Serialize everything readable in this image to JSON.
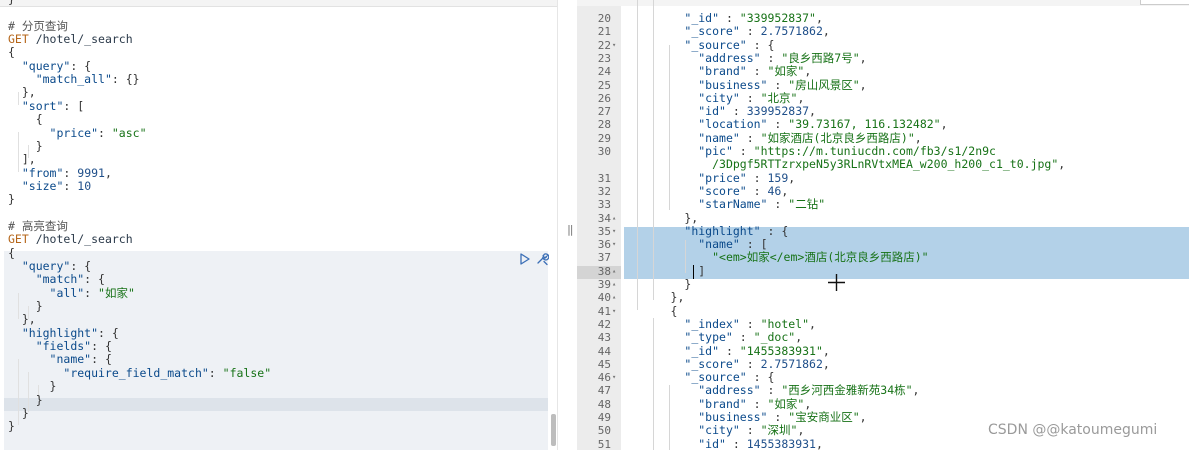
{
  "watermark": "CSDN @@katoumegumi",
  "left_lines": [
    [
      {
        "t": "}",
        "c": "punc"
      }
    ],
    [],
    [
      {
        "t": "# 分页查询",
        "c": "cmt"
      }
    ],
    [
      {
        "t": "GET ",
        "c": "method"
      },
      {
        "t": "/hotel/_search",
        "c": "path"
      }
    ],
    [
      {
        "t": "{",
        "c": "punc"
      }
    ],
    [
      {
        "t": "  ",
        "c": "punc"
      },
      {
        "t": "\"query\"",
        "c": "key"
      },
      {
        "t": ": {",
        "c": "punc"
      }
    ],
    [
      {
        "t": "    ",
        "c": "punc"
      },
      {
        "t": "\"match_all\"",
        "c": "key"
      },
      {
        "t": ": {}",
        "c": "punc"
      }
    ],
    [
      {
        "t": "  },",
        "c": "punc"
      }
    ],
    [
      {
        "t": "  ",
        "c": "punc"
      },
      {
        "t": "\"sort\"",
        "c": "key"
      },
      {
        "t": ": [",
        "c": "punc"
      }
    ],
    [
      {
        "t": "    {",
        "c": "punc"
      }
    ],
    [
      {
        "t": "      ",
        "c": "punc"
      },
      {
        "t": "\"price\"",
        "c": "key"
      },
      {
        "t": ": ",
        "c": "punc"
      },
      {
        "t": "\"asc\"",
        "c": "str"
      }
    ],
    [
      {
        "t": "    }",
        "c": "punc"
      }
    ],
    [
      {
        "t": "  ],",
        "c": "punc"
      }
    ],
    [
      {
        "t": "  ",
        "c": "punc"
      },
      {
        "t": "\"from\"",
        "c": "key"
      },
      {
        "t": ": ",
        "c": "punc"
      },
      {
        "t": "9991",
        "c": "num"
      },
      {
        "t": ",",
        "c": "punc"
      }
    ],
    [
      {
        "t": "  ",
        "c": "punc"
      },
      {
        "t": "\"size\"",
        "c": "key"
      },
      {
        "t": ": ",
        "c": "punc"
      },
      {
        "t": "10",
        "c": "num"
      }
    ],
    [
      {
        "t": "}",
        "c": "punc"
      }
    ],
    [],
    [
      {
        "t": "# 高亮查询",
        "c": "cmt"
      }
    ],
    [
      {
        "t": "GET ",
        "c": "method"
      },
      {
        "t": "/hotel/_search",
        "c": "path"
      }
    ],
    [
      {
        "t": "{",
        "c": "punc"
      }
    ],
    [
      {
        "t": "  ",
        "c": "punc"
      },
      {
        "t": "\"query\"",
        "c": "key"
      },
      {
        "t": ": {",
        "c": "punc"
      }
    ],
    [
      {
        "t": "    ",
        "c": "punc"
      },
      {
        "t": "\"match\"",
        "c": "key"
      },
      {
        "t": ": {",
        "c": "punc"
      }
    ],
    [
      {
        "t": "      ",
        "c": "punc"
      },
      {
        "t": "\"all\"",
        "c": "key"
      },
      {
        "t": ": ",
        "c": "punc"
      },
      {
        "t": "\"如家\"",
        "c": "str"
      }
    ],
    [
      {
        "t": "    }",
        "c": "punc"
      }
    ],
    [
      {
        "t": "  },",
        "c": "punc"
      }
    ],
    [
      {
        "t": "  ",
        "c": "punc"
      },
      {
        "t": "\"highlight\"",
        "c": "key"
      },
      {
        "t": ": {",
        "c": "punc"
      }
    ],
    [
      {
        "t": "    ",
        "c": "punc"
      },
      {
        "t": "\"fields\"",
        "c": "key"
      },
      {
        "t": ": {",
        "c": "punc"
      }
    ],
    [
      {
        "t": "      ",
        "c": "punc"
      },
      {
        "t": "\"name\"",
        "c": "key"
      },
      {
        "t": ": {",
        "c": "punc"
      }
    ],
    [
      {
        "t": "        ",
        "c": "punc"
      },
      {
        "t": "\"require_field_match\"",
        "c": "key"
      },
      {
        "t": ": ",
        "c": "punc"
      },
      {
        "t": "\"false\"",
        "c": "str"
      }
    ],
    [
      {
        "t": "      }",
        "c": "punc"
      }
    ],
    [
      {
        "t": "    }",
        "c": "punc"
      }
    ],
    [
      {
        "t": "  }",
        "c": "punc"
      }
    ],
    [
      {
        "t": "}",
        "c": "punc"
      }
    ]
  ],
  "right_rows": [
    {
      "n": "20",
      "fold": "",
      "s": [
        {
          "t": "        ",
          "c": "punc"
        },
        {
          "t": "\"_id\"",
          "c": "key"
        },
        {
          "t": " : ",
          "c": "punc"
        },
        {
          "t": "\"339952837\"",
          "c": "str"
        },
        {
          "t": ",",
          "c": "punc"
        }
      ]
    },
    {
      "n": "21",
      "fold": "",
      "s": [
        {
          "t": "        ",
          "c": "punc"
        },
        {
          "t": "\"_score\"",
          "c": "key"
        },
        {
          "t": " : ",
          "c": "punc"
        },
        {
          "t": "2.7571862",
          "c": "num"
        },
        {
          "t": ",",
          "c": "punc"
        }
      ]
    },
    {
      "n": "22",
      "fold": "▾",
      "s": [
        {
          "t": "        ",
          "c": "punc"
        },
        {
          "t": "\"_source\"",
          "c": "key"
        },
        {
          "t": " : {",
          "c": "punc"
        }
      ]
    },
    {
      "n": "23",
      "fold": "",
      "s": [
        {
          "t": "          ",
          "c": "punc"
        },
        {
          "t": "\"address\"",
          "c": "key"
        },
        {
          "t": " : ",
          "c": "punc"
        },
        {
          "t": "\"良乡西路7号\"",
          "c": "str"
        },
        {
          "t": ",",
          "c": "punc"
        }
      ]
    },
    {
      "n": "24",
      "fold": "",
      "s": [
        {
          "t": "          ",
          "c": "punc"
        },
        {
          "t": "\"brand\"",
          "c": "key"
        },
        {
          "t": " : ",
          "c": "punc"
        },
        {
          "t": "\"如家\"",
          "c": "str"
        },
        {
          "t": ",",
          "c": "punc"
        }
      ]
    },
    {
      "n": "25",
      "fold": "",
      "s": [
        {
          "t": "          ",
          "c": "punc"
        },
        {
          "t": "\"business\"",
          "c": "key"
        },
        {
          "t": " : ",
          "c": "punc"
        },
        {
          "t": "\"房山风景区\"",
          "c": "str"
        },
        {
          "t": ",",
          "c": "punc"
        }
      ]
    },
    {
      "n": "26",
      "fold": "",
      "s": [
        {
          "t": "          ",
          "c": "punc"
        },
        {
          "t": "\"city\"",
          "c": "key"
        },
        {
          "t": " : ",
          "c": "punc"
        },
        {
          "t": "\"北京\"",
          "c": "str"
        },
        {
          "t": ",",
          "c": "punc"
        }
      ]
    },
    {
      "n": "27",
      "fold": "",
      "s": [
        {
          "t": "          ",
          "c": "punc"
        },
        {
          "t": "\"id\"",
          "c": "key"
        },
        {
          "t": " : ",
          "c": "punc"
        },
        {
          "t": "339952837",
          "c": "num"
        },
        {
          "t": ",",
          "c": "punc"
        }
      ]
    },
    {
      "n": "28",
      "fold": "",
      "s": [
        {
          "t": "          ",
          "c": "punc"
        },
        {
          "t": "\"location\"",
          "c": "key"
        },
        {
          "t": " : ",
          "c": "punc"
        },
        {
          "t": "\"39.73167, 116.132482\"",
          "c": "str"
        },
        {
          "t": ",",
          "c": "punc"
        }
      ]
    },
    {
      "n": "29",
      "fold": "",
      "s": [
        {
          "t": "          ",
          "c": "punc"
        },
        {
          "t": "\"name\"",
          "c": "key"
        },
        {
          "t": " : ",
          "c": "punc"
        },
        {
          "t": "\"如家酒店(北京良乡西路店)\"",
          "c": "str"
        },
        {
          "t": ",",
          "c": "punc"
        }
      ]
    },
    {
      "n": "30",
      "fold": "",
      "s": [
        {
          "t": "          ",
          "c": "punc"
        },
        {
          "t": "\"pic\"",
          "c": "key"
        },
        {
          "t": " : ",
          "c": "punc"
        },
        {
          "t": "\"https://m.tuniucdn.com/fb3/s1/2n9c",
          "c": "str"
        }
      ]
    },
    {
      "n": "",
      "fold": "",
      "s": [
        {
          "t": "            ",
          "c": "punc"
        },
        {
          "t": "/3Dpgf5RTTzrxpeN5y3RLnRVtxMEA_w200_h200_c1_t0.jpg\"",
          "c": "str"
        },
        {
          "t": ",",
          "c": "punc"
        }
      ]
    },
    {
      "n": "31",
      "fold": "",
      "s": [
        {
          "t": "          ",
          "c": "punc"
        },
        {
          "t": "\"price\"",
          "c": "key"
        },
        {
          "t": " : ",
          "c": "punc"
        },
        {
          "t": "159",
          "c": "num"
        },
        {
          "t": ",",
          "c": "punc"
        }
      ]
    },
    {
      "n": "32",
      "fold": "",
      "s": [
        {
          "t": "          ",
          "c": "punc"
        },
        {
          "t": "\"score\"",
          "c": "key"
        },
        {
          "t": " : ",
          "c": "punc"
        },
        {
          "t": "46",
          "c": "num"
        },
        {
          "t": ",",
          "c": "punc"
        }
      ]
    },
    {
      "n": "33",
      "fold": "",
      "s": [
        {
          "t": "          ",
          "c": "punc"
        },
        {
          "t": "\"starName\"",
          "c": "key"
        },
        {
          "t": " : ",
          "c": "punc"
        },
        {
          "t": "\"二钻\"",
          "c": "str"
        }
      ]
    },
    {
      "n": "34",
      "fold": "▴",
      "s": [
        {
          "t": "        },",
          "c": "punc"
        }
      ]
    },
    {
      "n": "35",
      "fold": "▾",
      "s": [
        {
          "t": "        ",
          "c": "punc"
        },
        {
          "t": "\"highlight\"",
          "c": "key"
        },
        {
          "t": " : {",
          "c": "punc"
        }
      ]
    },
    {
      "n": "36",
      "fold": "▾",
      "s": [
        {
          "t": "          ",
          "c": "punc"
        },
        {
          "t": "\"name\"",
          "c": "key"
        },
        {
          "t": " : [",
          "c": "punc"
        }
      ]
    },
    {
      "n": "37",
      "fold": "",
      "s": [
        {
          "t": "            ",
          "c": "punc"
        },
        {
          "t": "\"<em>如家</em>酒店(北京良乡西路店)\"",
          "c": "str"
        }
      ]
    },
    {
      "n": "38",
      "fold": "▴",
      "s": [
        {
          "t": "          ]",
          "c": "punc"
        }
      ]
    },
    {
      "n": "39",
      "fold": "▴",
      "s": [
        {
          "t": "        }",
          "c": "punc"
        }
      ]
    },
    {
      "n": "40",
      "fold": "▴",
      "s": [
        {
          "t": "      },",
          "c": "punc"
        }
      ]
    },
    {
      "n": "41",
      "fold": "▾",
      "s": [
        {
          "t": "      {",
          "c": "punc"
        }
      ]
    },
    {
      "n": "42",
      "fold": "",
      "s": [
        {
          "t": "        ",
          "c": "punc"
        },
        {
          "t": "\"_index\"",
          "c": "key"
        },
        {
          "t": " : ",
          "c": "punc"
        },
        {
          "t": "\"hotel\"",
          "c": "str"
        },
        {
          "t": ",",
          "c": "punc"
        }
      ]
    },
    {
      "n": "43",
      "fold": "",
      "s": [
        {
          "t": "        ",
          "c": "punc"
        },
        {
          "t": "\"_type\"",
          "c": "key"
        },
        {
          "t": " : ",
          "c": "punc"
        },
        {
          "t": "\"_doc\"",
          "c": "str"
        },
        {
          "t": ",",
          "c": "punc"
        }
      ]
    },
    {
      "n": "44",
      "fold": "",
      "s": [
        {
          "t": "        ",
          "c": "punc"
        },
        {
          "t": "\"_id\"",
          "c": "key"
        },
        {
          "t": " : ",
          "c": "punc"
        },
        {
          "t": "\"1455383931\"",
          "c": "str"
        },
        {
          "t": ",",
          "c": "punc"
        }
      ]
    },
    {
      "n": "45",
      "fold": "",
      "s": [
        {
          "t": "        ",
          "c": "punc"
        },
        {
          "t": "\"_score\"",
          "c": "key"
        },
        {
          "t": " : ",
          "c": "punc"
        },
        {
          "t": "2.7571862",
          "c": "num"
        },
        {
          "t": ",",
          "c": "punc"
        }
      ]
    },
    {
      "n": "46",
      "fold": "▾",
      "s": [
        {
          "t": "        ",
          "c": "punc"
        },
        {
          "t": "\"_source\"",
          "c": "key"
        },
        {
          "t": " : {",
          "c": "punc"
        }
      ]
    },
    {
      "n": "47",
      "fold": "",
      "s": [
        {
          "t": "          ",
          "c": "punc"
        },
        {
          "t": "\"address\"",
          "c": "key"
        },
        {
          "t": " : ",
          "c": "punc"
        },
        {
          "t": "\"西乡河西金雅新苑34栋\"",
          "c": "str"
        },
        {
          "t": ",",
          "c": "punc"
        }
      ]
    },
    {
      "n": "48",
      "fold": "",
      "s": [
        {
          "t": "          ",
          "c": "punc"
        },
        {
          "t": "\"brand\"",
          "c": "key"
        },
        {
          "t": " : ",
          "c": "punc"
        },
        {
          "t": "\"如家\"",
          "c": "str"
        },
        {
          "t": ",",
          "c": "punc"
        }
      ]
    },
    {
      "n": "49",
      "fold": "",
      "s": [
        {
          "t": "          ",
          "c": "punc"
        },
        {
          "t": "\"business\"",
          "c": "key"
        },
        {
          "t": " : ",
          "c": "punc"
        },
        {
          "t": "\"宝安商业区\"",
          "c": "str"
        },
        {
          "t": ",",
          "c": "punc"
        }
      ]
    },
    {
      "n": "50",
      "fold": "",
      "s": [
        {
          "t": "          ",
          "c": "punc"
        },
        {
          "t": "\"city\"",
          "c": "key"
        },
        {
          "t": " : ",
          "c": "punc"
        },
        {
          "t": "\"深圳\"",
          "c": "str"
        },
        {
          "t": ",",
          "c": "punc"
        }
      ]
    },
    {
      "n": "51",
      "fold": "",
      "s": [
        {
          "t": "          ",
          "c": "punc"
        },
        {
          "t": "\"id\"",
          "c": "key"
        },
        {
          "t": " : ",
          "c": "punc"
        },
        {
          "t": "1455383931",
          "c": "num"
        },
        {
          "t": ",",
          "c": "punc"
        }
      ]
    }
  ]
}
